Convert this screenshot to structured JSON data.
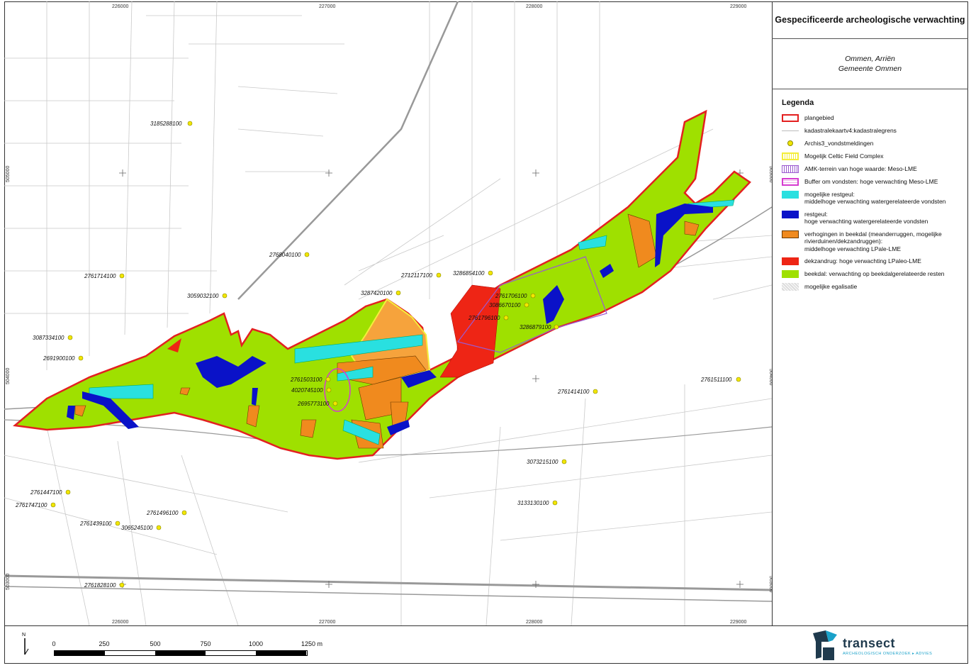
{
  "panel": {
    "title": "Gespecificeerde archeologische verwachting",
    "location_line1": "Ommen, Arriën",
    "location_line2": "Gemeente Ommen"
  },
  "legend": {
    "title": "Legenda",
    "items": [
      {
        "label": "plangebied",
        "color": "#e32020"
      },
      {
        "label": "kadastralekaartv4:kadastralegrens",
        "color": "#bbbbbb"
      },
      {
        "label": "Archis3_vondstmeldingen",
        "color": "#f2e600"
      },
      {
        "label": "Mogelijk Celtic Field Complex",
        "color": "#f4ee3c"
      },
      {
        "label": "AMK-terrein van hoge waarde: Meso-LME",
        "color": "#9b59d0"
      },
      {
        "label": "Buffer om vondsten: hoge verwachting Meso-LME",
        "color": "#d63bd0"
      },
      {
        "label": "mogelijke restgeul:",
        "label2": "middelhoge verwachting watergerelateerde vondsten",
        "color": "#29e0e0"
      },
      {
        "label": "restgeul:",
        "label2": "hoge verwachting watergerelateerde vondsten",
        "color": "#0a12c8"
      },
      {
        "label": "verhogingen in beekdal (meanderruggen, mogelijke rivierduinen/dekzandruggen):",
        "label2": "middelhoge verwachting LPale-LME",
        "color": "#f08a1e"
      },
      {
        "label": "dekzandrug: hoge verwachting LPaleo-LME",
        "color": "#ee2515"
      },
      {
        "label": "beekdal: verwachting op beekdalgerelateerde resten",
        "color": "#9fe000"
      },
      {
        "label": "mogelijke egalisatie",
        "color": "#cccccc"
      }
    ]
  },
  "map": {
    "top_coords": [
      "226000",
      "227000",
      "228000",
      "229000"
    ],
    "bottom_coords": [
      "226000",
      "227000",
      "228000",
      "229000"
    ],
    "left_coords": [
      "505000",
      "504000",
      "503000"
    ],
    "right_coords": [
      "505000",
      "504000",
      "503000"
    ],
    "finds": [
      "3185288100",
      "2768040100",
      "2761714100",
      "3059032100",
      "3087334100",
      "2691900100",
      "2712117100",
      "3286854100",
      "3287420100",
      "2761706100",
      "3086670100",
      "2761796100",
      "3286879100",
      "2761503100",
      "4020745100",
      "2695773100",
      "2761414100",
      "2761511100",
      "3073215100",
      "3133130100",
      "2761447100",
      "2761747100",
      "2761496100",
      "2761439100",
      "3065245100",
      "2761828100"
    ]
  },
  "scalebar": {
    "labels": [
      "0",
      "250",
      "500",
      "750",
      "1000",
      "1250 m"
    ],
    "north": "N"
  },
  "logo": {
    "name": "transect",
    "tagline": "ARCHEOLOGISCH ONDERZOEK ▸ ADVIES"
  }
}
